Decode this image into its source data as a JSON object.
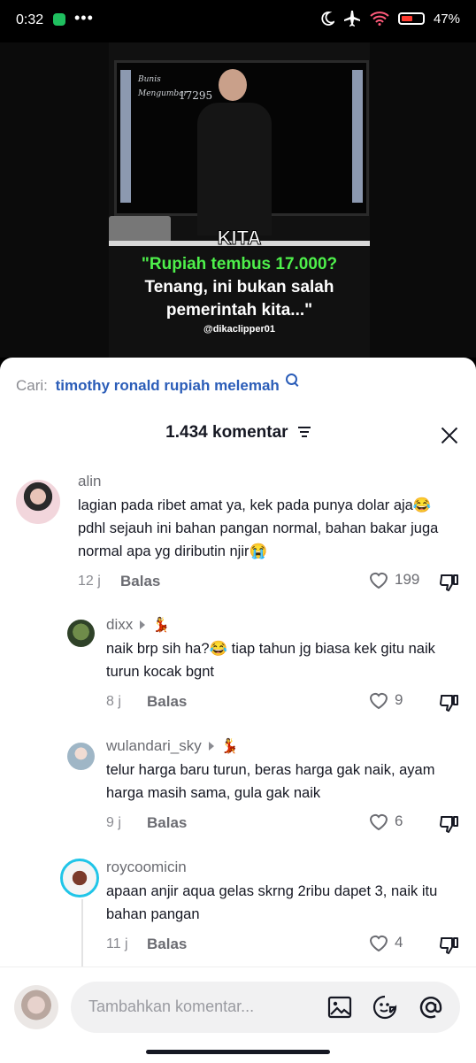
{
  "status_bar": {
    "time": "0:32",
    "dots": "•••",
    "battery": "47%"
  },
  "video": {
    "board_line1": "Bunis",
    "board_line2": "Mengumbar",
    "board_number": "17295",
    "caption_kita": "KITA",
    "caption_green": "\"Rupiah tembus 17.000?",
    "caption_white_1": "Tenang, ini bukan salah",
    "caption_white_2": "pemerintah kita...\"",
    "handle": "@dikaclipper01"
  },
  "search": {
    "prefix": "Cari:",
    "query": "timothy ronald rupiah melemah"
  },
  "header": {
    "count_label": "1.434 komentar"
  },
  "comments": [
    {
      "username": "alin",
      "lines": [
        "lagian pada ribet amat ya, kek pada punya dolar aja😂",
        "pdhl sejauh ini bahan pangan normal, bahan bakar juga",
        "normal apa yg diributin njir😭"
      ],
      "time": "12 j",
      "reply": "Balas",
      "likes": "199"
    },
    {
      "username": "dixx",
      "lines": [
        "naik brp sih ha?😂 tiap tahun jg biasa kek gitu naik",
        "turun kocak bgnt"
      ],
      "time": "8 j",
      "reply": "Balas",
      "likes": "9"
    },
    {
      "username": "wulandari_sky",
      "lines": [
        "telur harga baru turun, beras harga gak naik, ayam",
        "harga masih sama, gula gak naik"
      ],
      "time": "9 j",
      "reply": "Balas",
      "likes": "6"
    },
    {
      "username": "roycoomicin",
      "lines": [
        "apaan anjir aqua gelas skrng 2ribu dapet 3, naik itu",
        "bahan pangan"
      ],
      "time": "11 j",
      "reply": "Balas",
      "likes": "4"
    }
  ],
  "input": {
    "placeholder": "Tambahkan komentar..."
  },
  "colors": {
    "accent_link": "#2b5db8",
    "caption_green": "#4ef04b",
    "battery_low": "#ff3b30"
  }
}
